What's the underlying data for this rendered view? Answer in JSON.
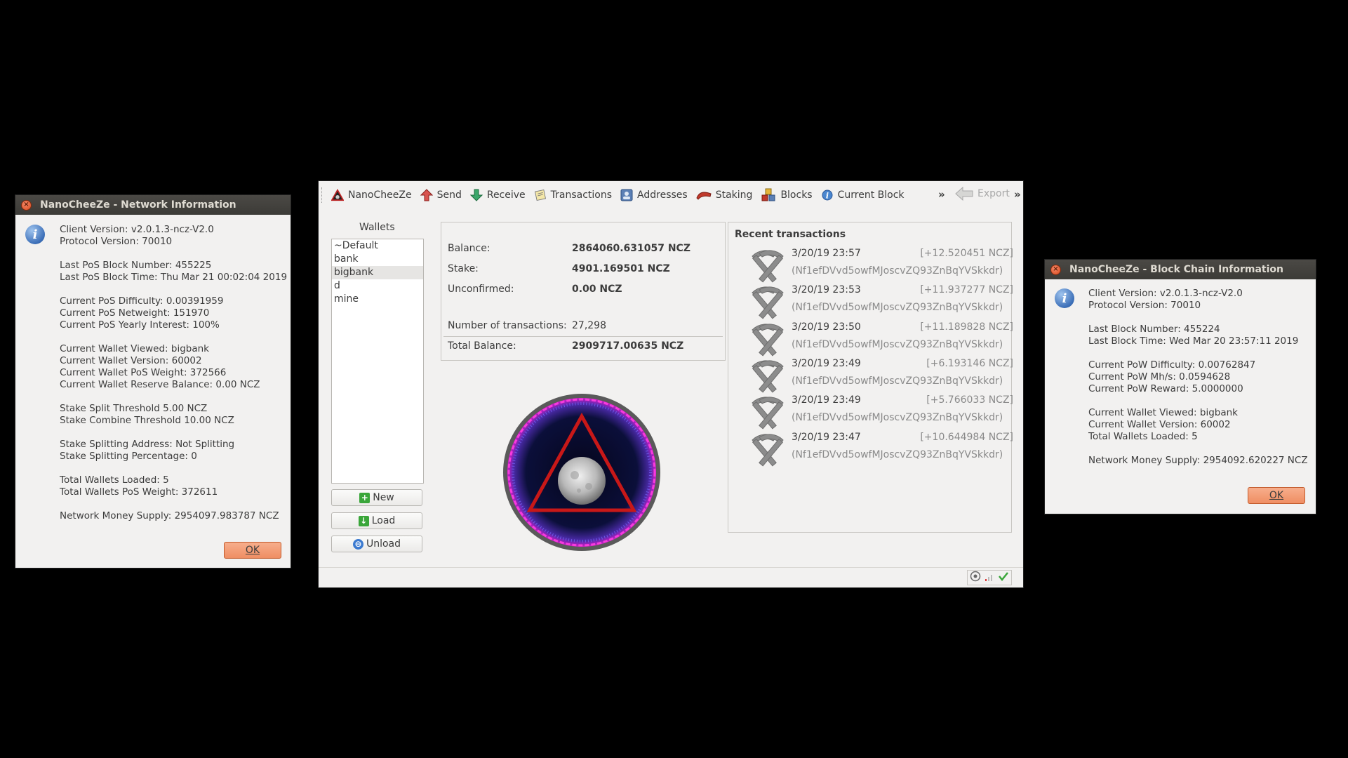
{
  "network_dialog": {
    "title": "NanoCheeZe - Network Information",
    "lines": [
      "Client Version: v2.0.1.3-ncz-V2.0",
      "Protocol Version: 70010",
      "",
      "Last PoS Block Number: 455225",
      "Last PoS Block Time: Thu Mar 21 00:02:04 2019",
      "",
      "Current PoS Difficulty: 0.00391959",
      "Current PoS Netweight: 151970",
      "Current PoS Yearly Interest: 100%",
      "",
      "Current Wallet Viewed: bigbank",
      "Current Wallet Version: 60002",
      "Current Wallet PoS Weight: 372566",
      "Current Wallet Reserve Balance: 0.00 NCZ",
      "",
      "Stake Split Threshold 5.00 NCZ",
      "Stake Combine Threshold 10.00 NCZ",
      "",
      "Stake Splitting Address: Not Splitting",
      "Stake Splitting Percentage: 0",
      "",
      "Total Wallets Loaded: 5",
      "Total Wallets PoS Weight: 372611",
      "",
      "Network Money Supply: 2954097.983787 NCZ"
    ],
    "ok_label": "OK"
  },
  "blockchain_dialog": {
    "title": "NanoCheeZe - Block Chain Information",
    "lines": [
      "Client Version: v2.0.1.3-ncz-V2.0",
      "Protocol Version: 70010",
      "",
      "Last Block Number: 455224",
      "Last Block Time: Wed Mar 20 23:57:11 2019",
      "",
      "Current PoW Difficulty: 0.00762847",
      "Current PoW Mh/s: 0.0594628",
      "Current PoW Reward: 5.0000000",
      "",
      "Current Wallet Viewed: bigbank",
      "Current Wallet Version: 60002",
      "Total Wallets Loaded: 5",
      "",
      "Network Money Supply: 2954092.620227 NCZ"
    ],
    "ok_label": "OK"
  },
  "toolbar": {
    "items": [
      {
        "label": "NanoCheeZe",
        "icon": "nanocheeze-logo-icon"
      },
      {
        "label": "Send",
        "icon": "send-icon"
      },
      {
        "label": "Receive",
        "icon": "receive-icon"
      },
      {
        "label": "Transactions",
        "icon": "transactions-icon"
      },
      {
        "label": "Addresses",
        "icon": "addresses-icon"
      },
      {
        "label": "Staking",
        "icon": "staking-icon"
      },
      {
        "label": "Blocks",
        "icon": "blocks-icon"
      },
      {
        "label": "Current Block",
        "icon": "info-icon"
      }
    ],
    "overflow": "»",
    "export_label": "Export",
    "overflow2": "»"
  },
  "wallets": {
    "heading": "Wallets",
    "items": [
      "~Default",
      "bank",
      "bigbank",
      "d",
      "mine"
    ],
    "selected": "bigbank",
    "new_label": "New",
    "load_label": "Load",
    "unload_label": "Unload"
  },
  "overview": {
    "balance_label": "Balance:",
    "balance_value": "2864060.631057 NCZ",
    "stake_label": "Stake:",
    "stake_value": "4901.169501 NCZ",
    "unconfirmed_label": "Unconfirmed:",
    "unconfirmed_value": "0.00 NCZ",
    "num_tx_label": "Number of transactions:",
    "num_tx_value": "27,298",
    "total_label": "Total Balance:",
    "total_value": "2909717.00635 NCZ"
  },
  "recent": {
    "heading": "Recent transactions",
    "transactions": [
      {
        "date": "3/20/19 23:57",
        "amount": "[+12.520451 NCZ]",
        "address": "(Nf1efDVvd5owfMJoscvZQ93ZnBqYVSkkdr)"
      },
      {
        "date": "3/20/19 23:53",
        "amount": "[+11.937277 NCZ]",
        "address": "(Nf1efDVvd5owfMJoscvZQ93ZnBqYVSkkdr)"
      },
      {
        "date": "3/20/19 23:50",
        "amount": "[+11.189828 NCZ]",
        "address": "(Nf1efDVvd5owfMJoscvZQ93ZnBqYVSkkdr)"
      },
      {
        "date": "3/20/19 23:49",
        "amount": "[+6.193146 NCZ]",
        "address": "(Nf1efDVvd5owfMJoscvZQ93ZnBqYVSkkdr)"
      },
      {
        "date": "3/20/19 23:49",
        "amount": "[+5.766033 NCZ]",
        "address": "(Nf1efDVvd5owfMJoscvZQ93ZnBqYVSkkdr)"
      },
      {
        "date": "3/20/19 23:47",
        "amount": "[+10.644984 NCZ]",
        "address": "(Nf1efDVvd5owfMJoscvZQ93ZnBqYVSkkdr)"
      }
    ]
  },
  "statusbar": {
    "icons": [
      "connections-icon",
      "signal-icon",
      "synced-check-icon"
    ]
  },
  "colors": {
    "desktop": "#000000",
    "titlebar": "#3c3b37",
    "window_bg": "#f2f1f0",
    "ok_button": "#ef8e63",
    "tx_secondary_text": "#8a8a8a"
  }
}
